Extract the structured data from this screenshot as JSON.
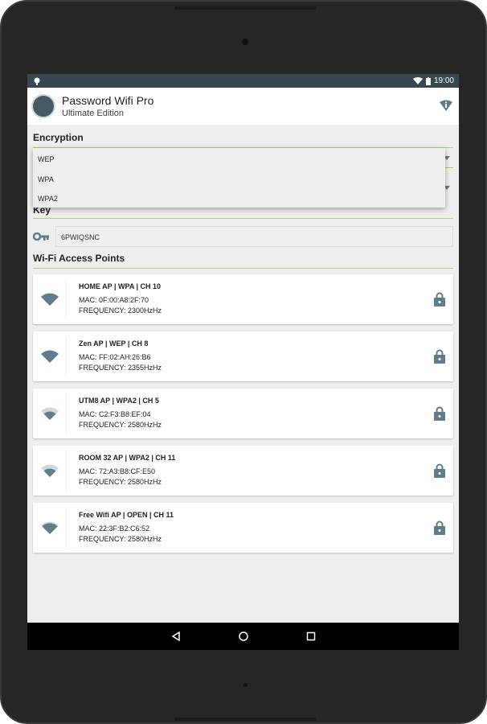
{
  "status_bar": {
    "time": "19:00",
    "icons": [
      "android-debug-icon",
      "wifi-icon",
      "battery-icon"
    ]
  },
  "app_bar": {
    "title": "Password Wifi Pro",
    "subtitle": "Ultimate Edition",
    "action_icon": "wifi-info-icon"
  },
  "encryption": {
    "label": "Encryption",
    "options": [
      "WEP",
      "WPA",
      "WPA2"
    ]
  },
  "key": {
    "label": "Key",
    "value": "6PWIQSNC"
  },
  "access_points": {
    "label": "Wi-Fi Access Points",
    "items": [
      {
        "name": "HOME AP | WPA | CH 10",
        "mac": "MAC: 0F:00:A8:2F:70",
        "frequency": "FREQUENCY: 2300HzHz",
        "signal": 1.0
      },
      {
        "name": "Zen AP | WEP | CH 8",
        "mac": "MAC: FF:02:AH:26:B6",
        "frequency": "FREQUENCY: 2355HzHz",
        "signal": 0.75
      },
      {
        "name": "UTM8 AP | WPA2 | CH 5",
        "mac": "MAC: C2:F3:B8:EF:04",
        "frequency": "FREQUENCY: 2580HzHz",
        "signal": 0.5
      },
      {
        "name": "ROOM 32 AP | WPA2 | CH 11",
        "mac": "MAC: 72:A3:B8:CF:E50",
        "frequency": "FREQUENCY: 2580HzHz",
        "signal": 0.5
      },
      {
        "name": "Free Wifi AP | OPEN | CH 11",
        "mac": "MAC: 22:3F:B2:C6:52",
        "frequency": "FREQUENCY: 2580HzHz",
        "signal": 0.65
      }
    ]
  },
  "colors": {
    "status_bar": "#37474f",
    "accent_line": "#9ccc65",
    "icon": "#607d8b"
  }
}
